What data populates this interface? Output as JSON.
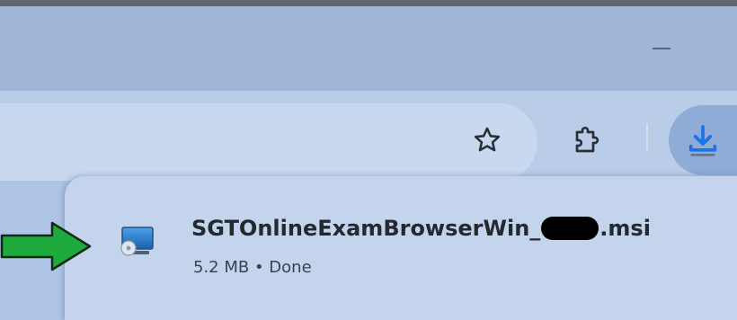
{
  "window": {
    "minimize_icon": "minimize-icon"
  },
  "toolbar": {
    "bookmark_icon": "star-icon",
    "extensions_icon": "puzzle-icon",
    "downloads_icon": "download-icon"
  },
  "downloads": {
    "items": [
      {
        "filename_prefix": "SGTOnlineExamBrowserWin_",
        "filename_suffix": ".msi",
        "meta": "5.2 MB • Done",
        "icon": "installer-icon"
      }
    ]
  },
  "annotation": {
    "arrow_icon": "green-arrow-icon",
    "arrow_color": "#1faa3e"
  },
  "colors": {
    "titlebar": "#9fb6d8",
    "toolbar": "#b9cde9",
    "panel": "#c3d4ec",
    "download_accent": "#1a73e8"
  }
}
